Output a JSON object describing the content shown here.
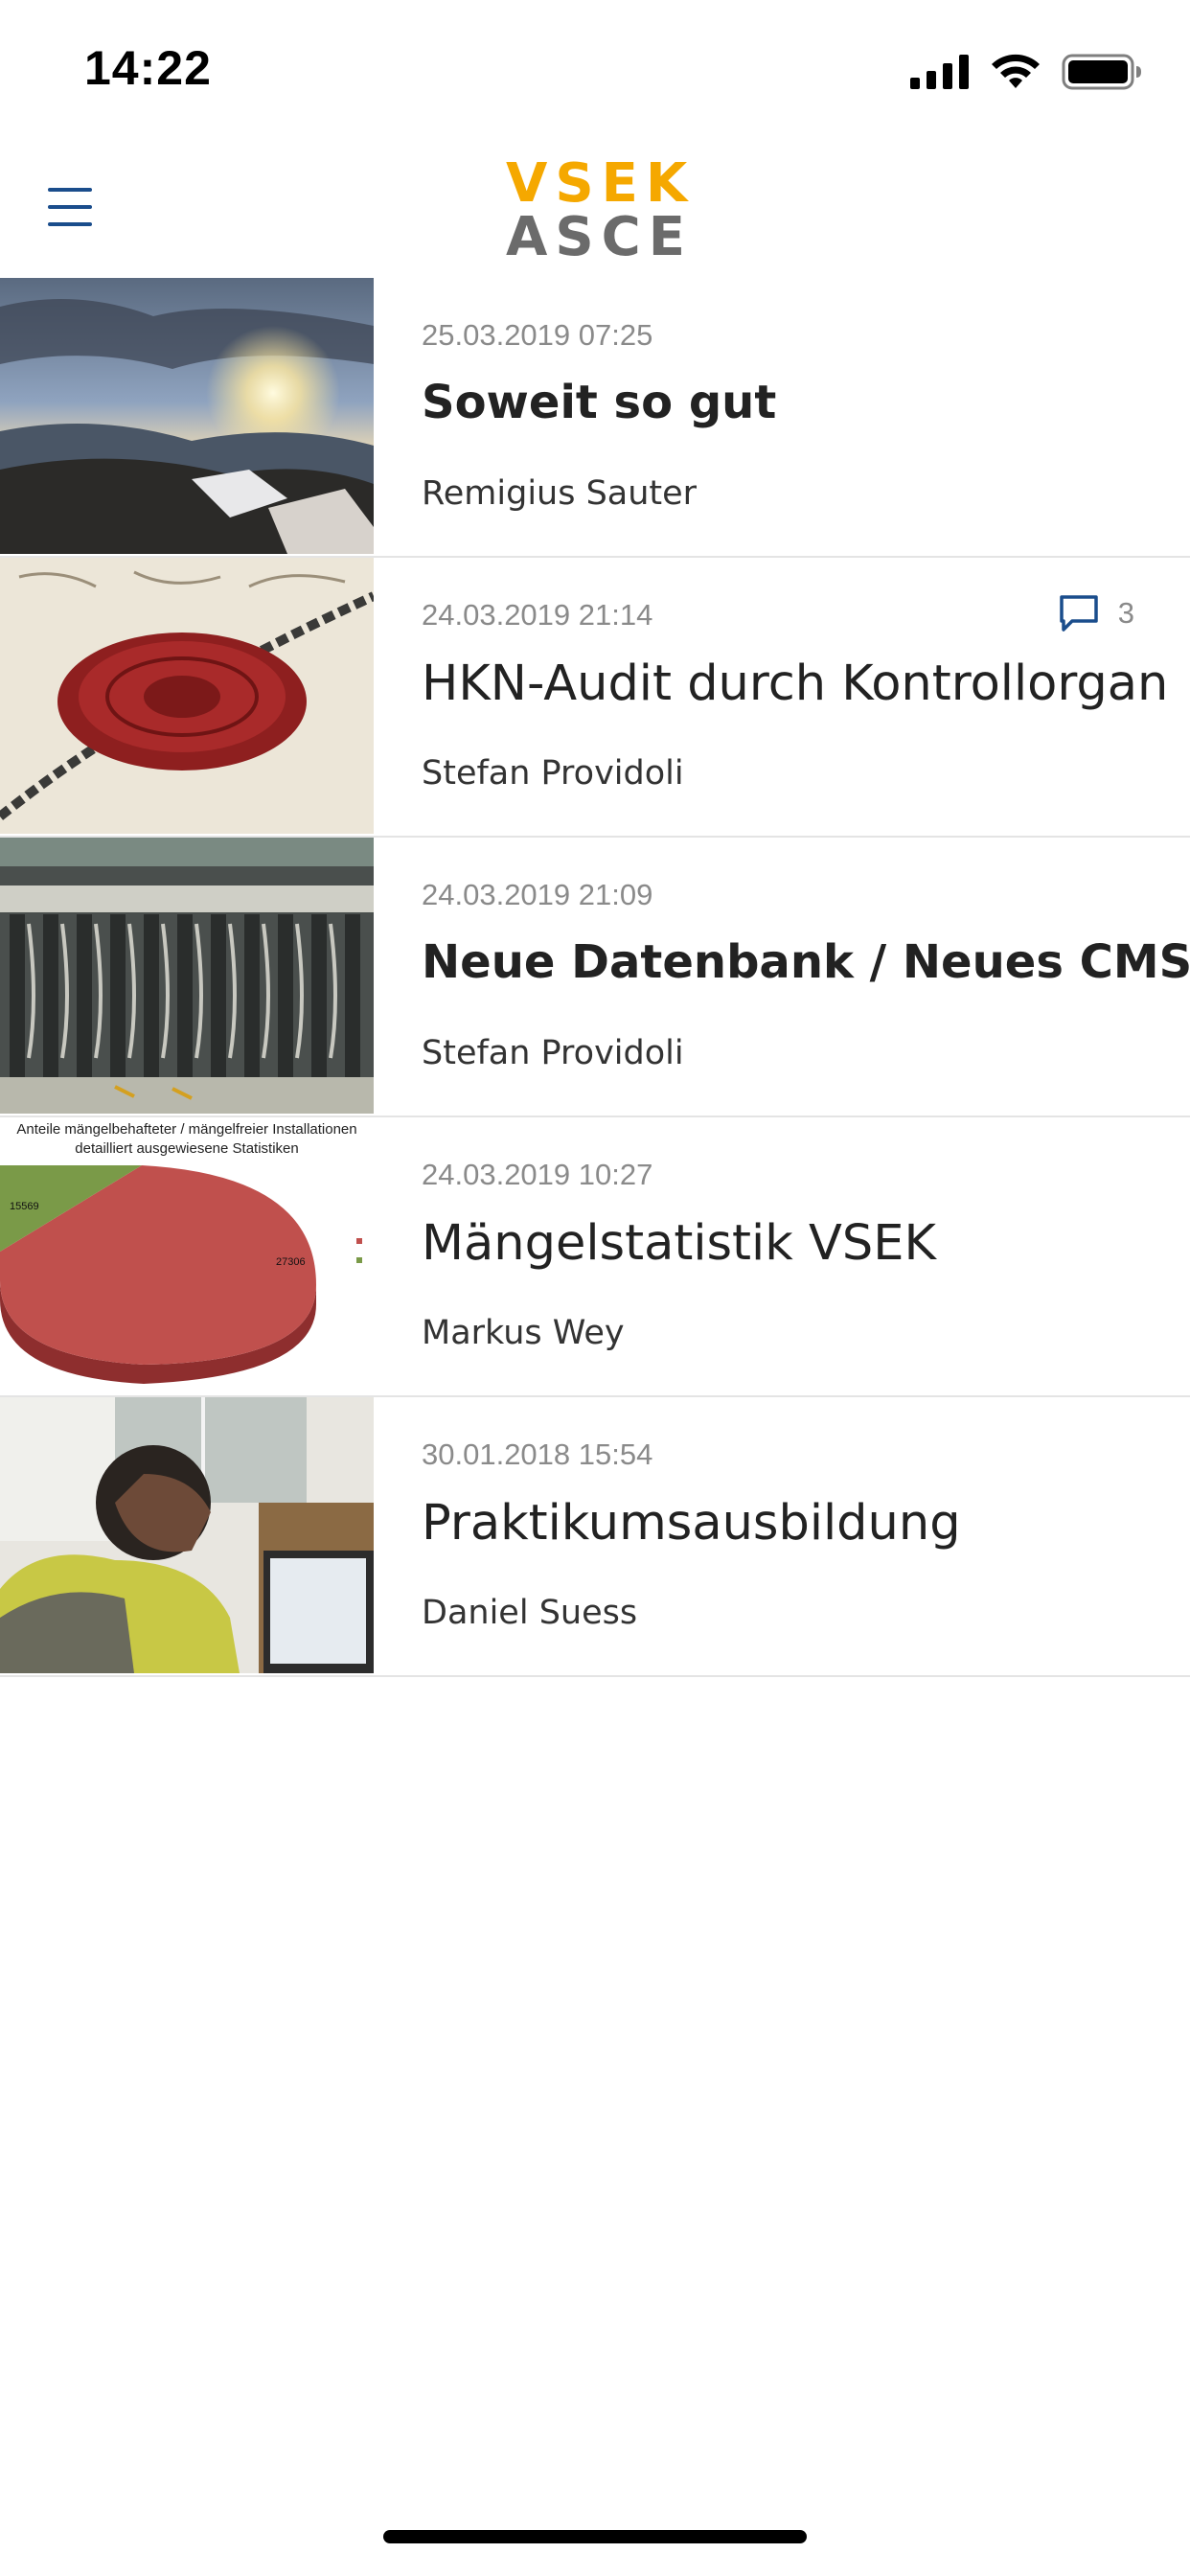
{
  "status_bar": {
    "time": "14:22",
    "icons": [
      "signal-icon",
      "wifi-icon",
      "battery-icon"
    ]
  },
  "header": {
    "menu_icon": "hamburger-menu-icon",
    "logo_line1": "VSEK",
    "logo_line2": "ASCE",
    "colors": {
      "accent_blue": "#1a4d8c",
      "logo_orange": "#f5a800",
      "logo_gray": "#6b6b6b"
    }
  },
  "articles": [
    {
      "date": "25.03.2019 07:25",
      "title": "Soweit so gut",
      "author": "Remigius Sauter",
      "thumbnail": "mountain-sunset-image"
    },
    {
      "date": "24.03.2019 21:14",
      "title": "HKN-Audit durch Kontrollorgan",
      "author": "Stefan Providoli",
      "comments": "3",
      "thumbnail": "wax-seal-image"
    },
    {
      "date": "24.03.2019 21:09",
      "title": "Neue Datenbank / Neues CMS",
      "author": "Stefan Providoli",
      "thumbnail": "server-cables-image"
    },
    {
      "date": "24.03.2019 10:27",
      "title": "Mängelstatistik VSEK",
      "author": "Markus Wey",
      "thumbnail": "pie-chart-image",
      "thumb_chart": {
        "title_line1": "Anteile  mängelbehafteter / mängelfreier Installationen",
        "title_line2": "detailliert ausgewiesene Statistiken",
        "value_green": "15569",
        "value_red": "27306"
      }
    },
    {
      "date": "30.01.2018 15:54",
      "title": "Praktikumsausbildung",
      "author": "Daniel Suess",
      "thumbnail": "worker-at-computer-image"
    }
  ]
}
